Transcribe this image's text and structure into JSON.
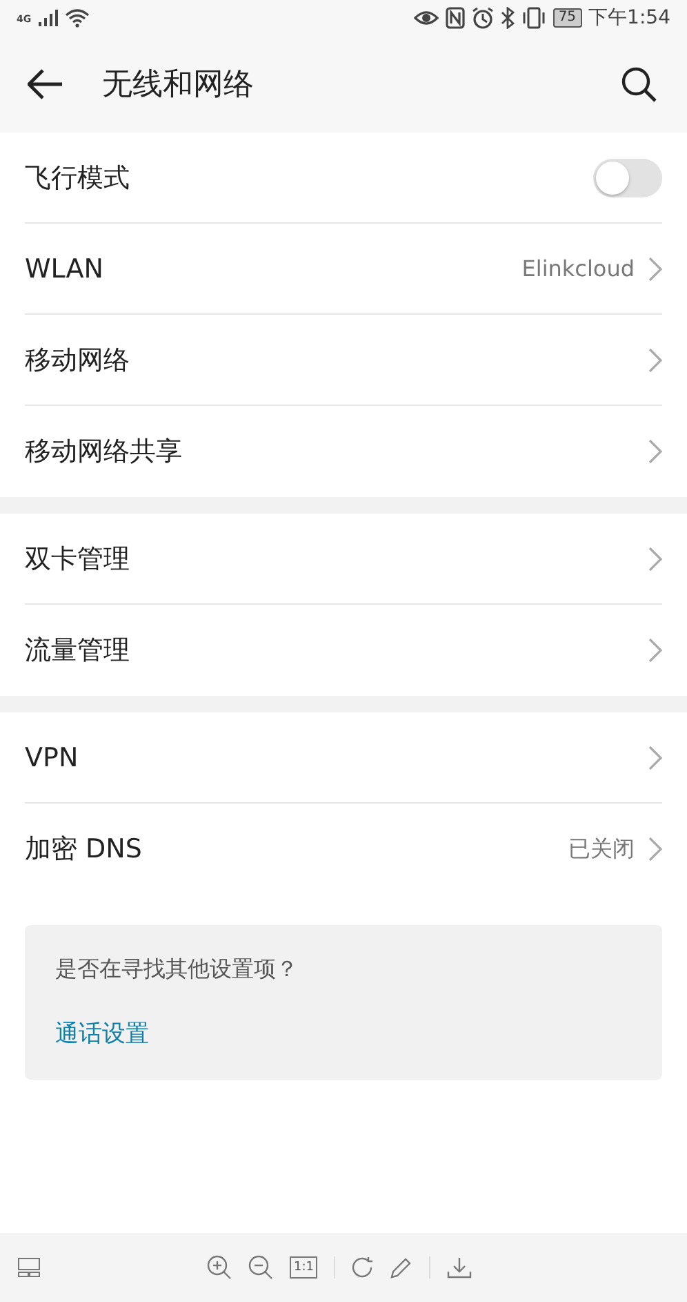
{
  "status_bar": {
    "network": "4G",
    "battery": "75",
    "time": "下午1:54"
  },
  "header": {
    "title": "无线和网络"
  },
  "groups": [
    {
      "items": [
        {
          "kind": "toggle",
          "label": "飞行模式",
          "on": false
        },
        {
          "kind": "link",
          "label": "WLAN",
          "value": "Elinkcloud"
        },
        {
          "kind": "link",
          "label": "移动网络"
        },
        {
          "kind": "link",
          "label": "移动网络共享"
        }
      ]
    },
    {
      "items": [
        {
          "kind": "link",
          "label": "双卡管理"
        },
        {
          "kind": "link",
          "label": "流量管理"
        }
      ]
    },
    {
      "items": [
        {
          "kind": "link",
          "label": "VPN"
        },
        {
          "kind": "link",
          "label": "加密 DNS",
          "value": "已关闭"
        }
      ]
    }
  ],
  "suggestion": {
    "question": "是否在寻找其他设置项？",
    "link": "通话设置"
  },
  "toolbar": {
    "actual_size": "1:1"
  }
}
